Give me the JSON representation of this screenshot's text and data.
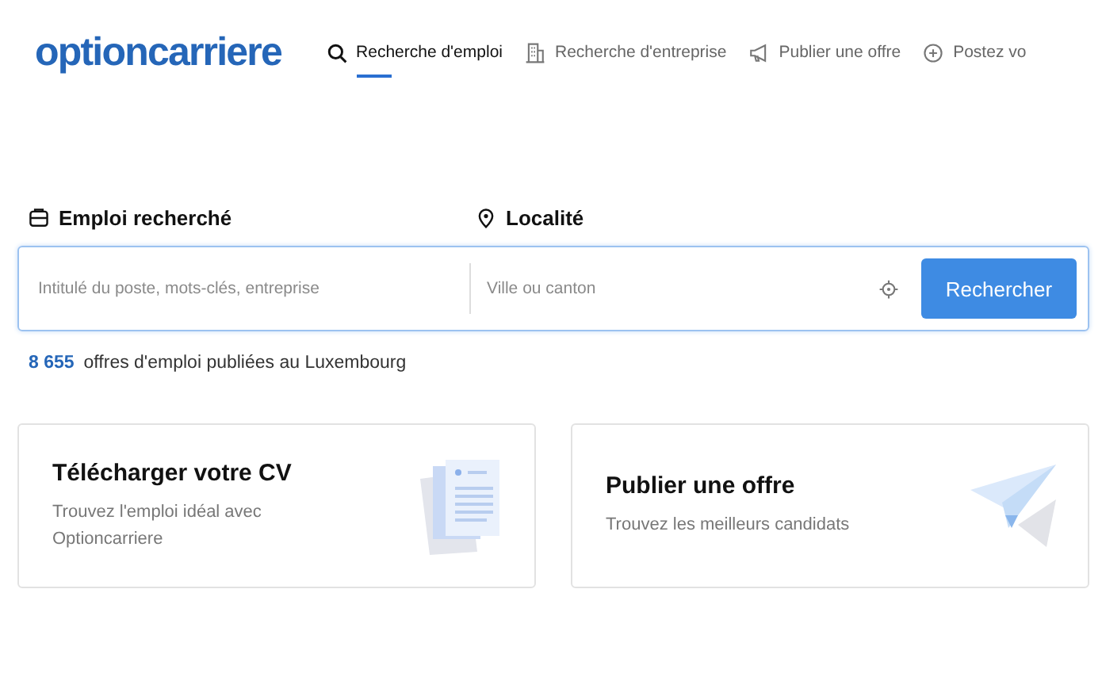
{
  "logo": "optioncarriere",
  "nav": [
    {
      "label": "Recherche d'emploi",
      "kind": "search",
      "selected": true
    },
    {
      "label": "Recherche d'entreprise",
      "kind": "building",
      "selected": false
    },
    {
      "label": "Publier une offre",
      "kind": "megaphone",
      "selected": false
    },
    {
      "label": "Postez vo",
      "kind": "plus",
      "selected": false
    }
  ],
  "search": {
    "job_label": "Emploi recherché",
    "location_label": "Localité",
    "job_placeholder": "Intitulé du poste, mots-clés, entreprise",
    "location_placeholder": "Ville ou canton",
    "button": "Rechercher"
  },
  "count": {
    "number": "8 655",
    "text": "offres d'emploi publiées au Luxembourg"
  },
  "cards": [
    {
      "title": "Télécharger votre CV",
      "text": "Trouvez l'emploi idéal avec Optioncarriere",
      "kind": "cv"
    },
    {
      "title": "Publier une offre",
      "text": "Trouvez les meilleurs candidats",
      "kind": "plane"
    }
  ]
}
